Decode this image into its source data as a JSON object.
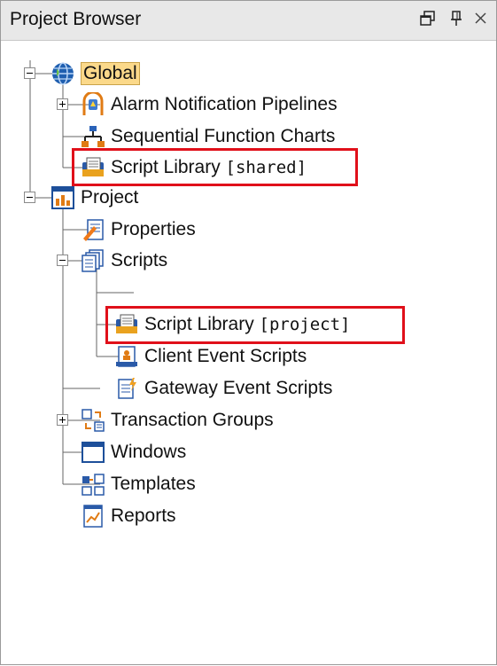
{
  "panel": {
    "title": "Project Browser",
    "buttons": [
      {
        "name": "restore-icon"
      },
      {
        "name": "pin-icon"
      },
      {
        "name": "close-icon"
      }
    ]
  },
  "tree": {
    "global": {
      "label": "Global",
      "icon": "globe-icon",
      "expanded": true,
      "selected": true
    },
    "alarm": {
      "label": "Alarm Notification Pipelines",
      "icon": "alarm-pipeline-icon",
      "expanded": false
    },
    "sfc": {
      "label": "Sequential Function Charts",
      "icon": "sfc-icon"
    },
    "shared_lib": {
      "label": "Script Library ",
      "suffix": "[shared]",
      "icon": "script-library-icon"
    },
    "project": {
      "label": "Project",
      "icon": "project-icon",
      "expanded": true
    },
    "properties": {
      "label": "Properties",
      "icon": "properties-icon"
    },
    "scripts": {
      "label": "Scripts",
      "icon": "scripts-icon",
      "expanded": true
    },
    "project_lib": {
      "label": "Script Library ",
      "suffix": "[project]",
      "icon": "script-library-icon"
    },
    "client_events": {
      "label": "Client Event Scripts",
      "icon": "client-event-scripts-icon"
    },
    "gateway_events": {
      "label": "Gateway Event Scripts",
      "icon": "gateway-event-scripts-icon"
    },
    "transaction": {
      "label": "Transaction Groups",
      "icon": "transaction-groups-icon"
    },
    "windows": {
      "label": "Windows",
      "icon": "windows-icon",
      "expanded": false
    },
    "templates": {
      "label": "Templates",
      "icon": "templates-icon"
    },
    "reports": {
      "label": "Reports",
      "icon": "reports-icon"
    }
  },
  "colors": {
    "highlight": "#e0101a",
    "selection": "#fbd98a",
    "titlebar": "#e8e8e8"
  }
}
